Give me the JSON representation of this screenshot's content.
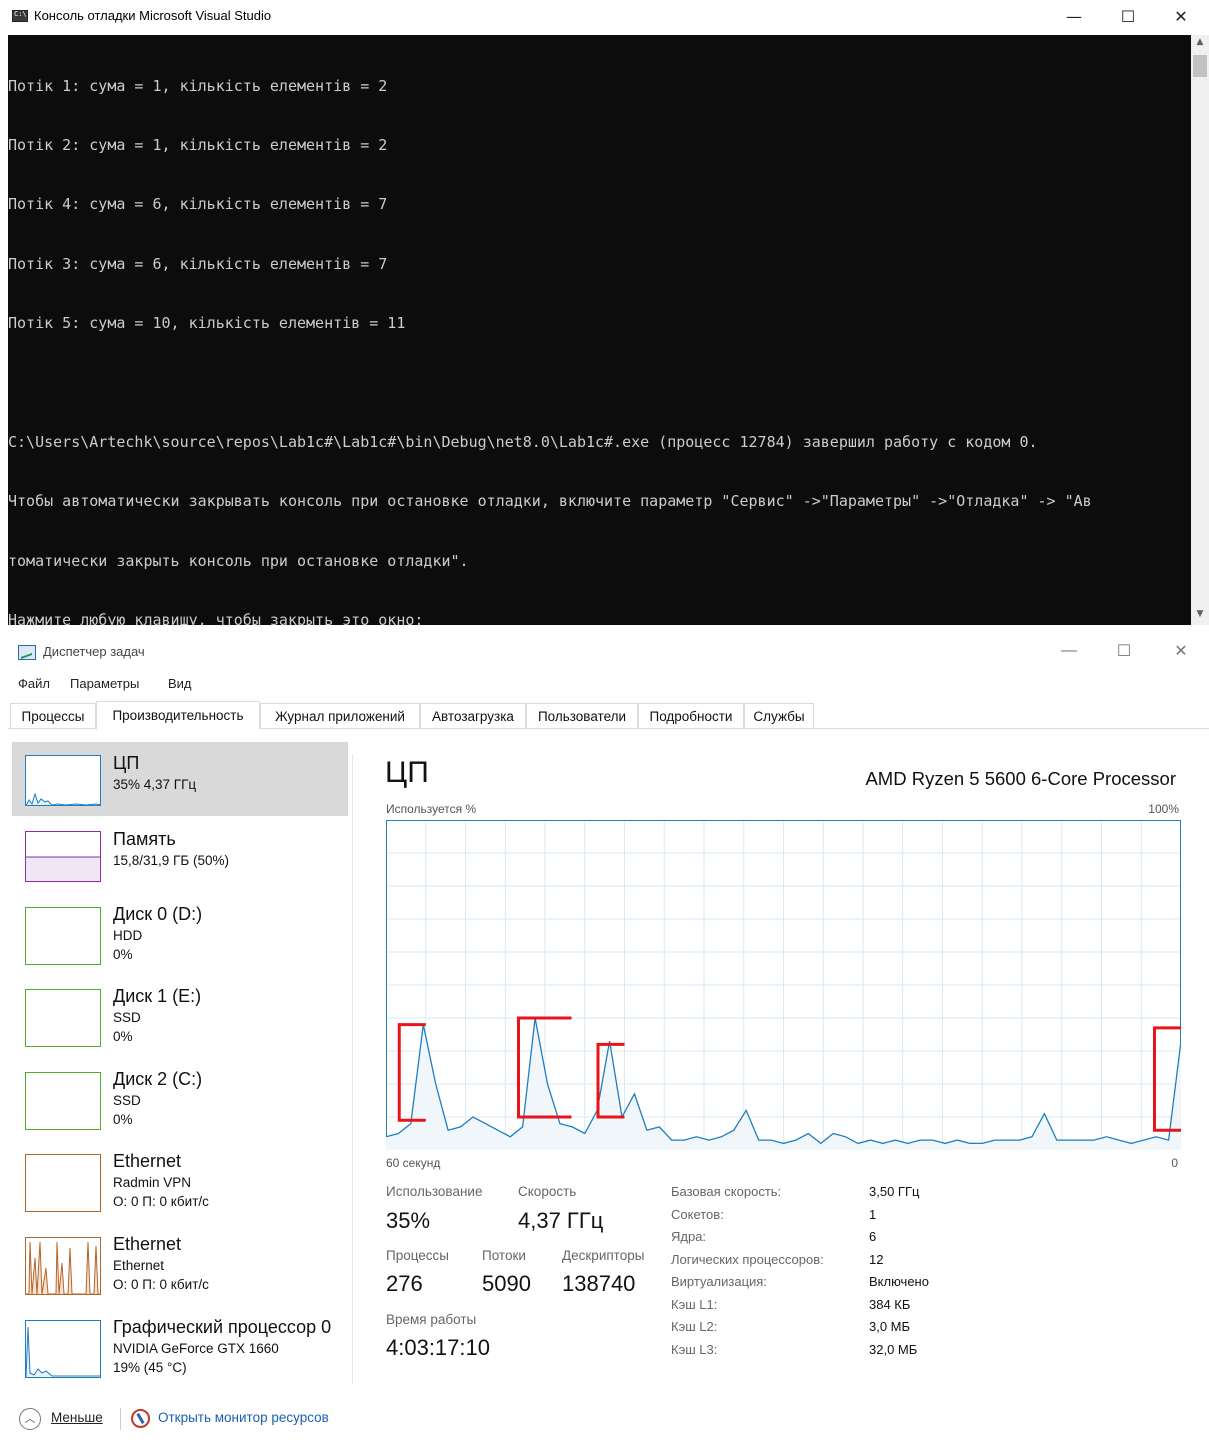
{
  "console": {
    "title": "Консоль отладки Microsoft Visual Studio",
    "controls": {
      "minimize": "—",
      "maximize": "☐",
      "close": "✕"
    },
    "lines": [
      "Потік 1: сума = 1, кількість елементів = 2",
      "Потік 2: сума = 1, кількість елементів = 2",
      "Потік 4: сума = 6, кількість елементів = 7",
      "Потік 3: сума = 6, кількість елементів = 7",
      "Потік 5: сума = 10, кількість елементів = 11",
      "",
      "C:\\Users\\Artechk\\source\\repos\\Lab1c#\\Lab1c#\\bin\\Debug\\net8.0\\Lab1c#.exe (процесс 12784) завершил работу с кодом 0.",
      "Чтобы автоматически закрывать консоль при остановке отладки, включите параметр \"Сервис\" ->\"Параметры\" ->\"Отладка\" -> \"Ав",
      "томатически закрыть консоль при остановке отладки\".",
      "Нажмите любую клавишу, чтобы закрыть это окно:"
    ],
    "scroll_up": "▲",
    "scroll_down": "▼"
  },
  "taskmanager": {
    "title": "Диспетчер задач",
    "controls": {
      "minimize": "—",
      "maximize": "☐",
      "close": "✕"
    },
    "menu": [
      "Файл",
      "Параметры",
      "Вид"
    ],
    "tabs": [
      "Процессы",
      "Производительность",
      "Журнал приложений",
      "Автозагрузка",
      "Пользователи",
      "Подробности",
      "Службы"
    ],
    "active_tab": "Производительность",
    "resources": [
      {
        "name": "ЦП",
        "sub1": "35% 4,37 ГГц",
        "sub2": "",
        "sub3": "",
        "color": "#1f7ec2",
        "selected": true
      },
      {
        "name": "Память",
        "sub1": "15,8/31,9 ГБ (50%)",
        "sub2": "",
        "sub3": "",
        "color": "#8e2ca4",
        "selected": false
      },
      {
        "name": "Диск 0 (D:)",
        "sub1": "HDD",
        "sub2": "0%",
        "sub3": "",
        "color": "#4caf2a",
        "selected": false
      },
      {
        "name": "Диск 1 (E:)",
        "sub1": "SSD",
        "sub2": "0%",
        "sub3": "",
        "color": "#4caf2a",
        "selected": false
      },
      {
        "name": "Диск 2 (C:)",
        "sub1": "SSD",
        "sub2": "0%",
        "sub3": "",
        "color": "#4caf2a",
        "selected": false
      },
      {
        "name": "Ethernet",
        "sub1": "Radmin VPN",
        "sub2": "О: 0 П: 0 кбит/с",
        "sub3": "",
        "color": "#b5652a",
        "selected": false
      },
      {
        "name": "Ethernet",
        "sub1": "Ethernet",
        "sub2": "О: 0 П: 0 кбит/с",
        "sub3": "",
        "color": "#b5652a",
        "selected": false
      },
      {
        "name": "Графический процессор 0",
        "sub1": "NVIDIA GeForce GTX 1660",
        "sub2": "19% (45 °C)",
        "sub3": "",
        "color": "#1f7ec2",
        "selected": false
      }
    ],
    "cpu": {
      "heading": "ЦП",
      "model": "AMD Ryzen 5 5600 6-Core Processor",
      "graph_label": "Используется %",
      "graph_max": "100%",
      "axis_left": "60 секунд",
      "axis_right": "0",
      "stats": {
        "usage_label": "Использование",
        "usage_value": "35%",
        "speed_label": "Скорость",
        "speed_value": "4,37 ГГц",
        "processes_label": "Процессы",
        "processes_value": "276",
        "threads_label": "Потоки",
        "threads_value": "5090",
        "handles_label": "Дескрипторы",
        "handles_value": "138740",
        "uptime_label": "Время работы",
        "uptime_value": "4:03:17:10"
      },
      "specs": [
        {
          "label": "Базовая скорость:",
          "value": "3,50 ГГц"
        },
        {
          "label": "Сокетов:",
          "value": "1"
        },
        {
          "label": "Ядра:",
          "value": "6"
        },
        {
          "label": "Логических процессоров:",
          "value": "12"
        },
        {
          "label": "Виртуализация:",
          "value": "Включено"
        },
        {
          "label": "Кэш L1:",
          "value": "384 КБ"
        },
        {
          "label": "Кэш L2:",
          "value": "3,0 МБ"
        },
        {
          "label": "Кэш L3:",
          "value": "32,0 МБ"
        }
      ]
    },
    "footer": {
      "less_label": "Меньше",
      "monitor_link": "Открыть монитор ресурсов"
    }
  },
  "colors": {
    "cpu_line": "#1f7ec2",
    "cpu_fill": "#f1f6fa",
    "grid": "#d9eaf7",
    "annotation": "#e8141a",
    "console_bg": "#0c0c0c"
  },
  "chart_data": {
    "type": "area",
    "title": "ЦП",
    "ylabel": "Используется %",
    "xlabel": "60 секунд",
    "ylim": [
      0,
      100
    ],
    "x_range": [
      60,
      0
    ],
    "grid": true,
    "values": [
      4,
      5,
      8,
      38,
      20,
      6,
      7,
      10,
      8,
      6,
      4,
      7,
      40,
      20,
      8,
      7,
      5,
      12,
      33,
      10,
      17,
      6,
      7,
      3,
      3,
      4,
      3,
      4,
      6,
      12,
      3,
      3,
      2,
      3,
      5,
      2,
      5,
      4,
      2,
      3,
      2,
      3,
      2,
      3,
      3,
      2,
      3,
      2,
      2,
      3,
      3,
      3,
      4,
      11,
      3,
      3,
      3,
      3,
      4,
      3,
      2,
      3,
      4,
      3,
      33
    ],
    "annotations": [
      {
        "shape": "bracket",
        "x_from": 59,
        "x_to": 57,
        "y_from": 9,
        "y_to": 38
      },
      {
        "shape": "bracket",
        "x_from": 50,
        "x_to": 46,
        "y_from": 10,
        "y_to": 40
      },
      {
        "shape": "bracket",
        "x_from": 44,
        "x_to": 42,
        "y_from": 10,
        "y_to": 32
      },
      {
        "shape": "bracket",
        "x_from": 2,
        "x_to": 0,
        "y_from": 6,
        "y_to": 37
      }
    ]
  }
}
